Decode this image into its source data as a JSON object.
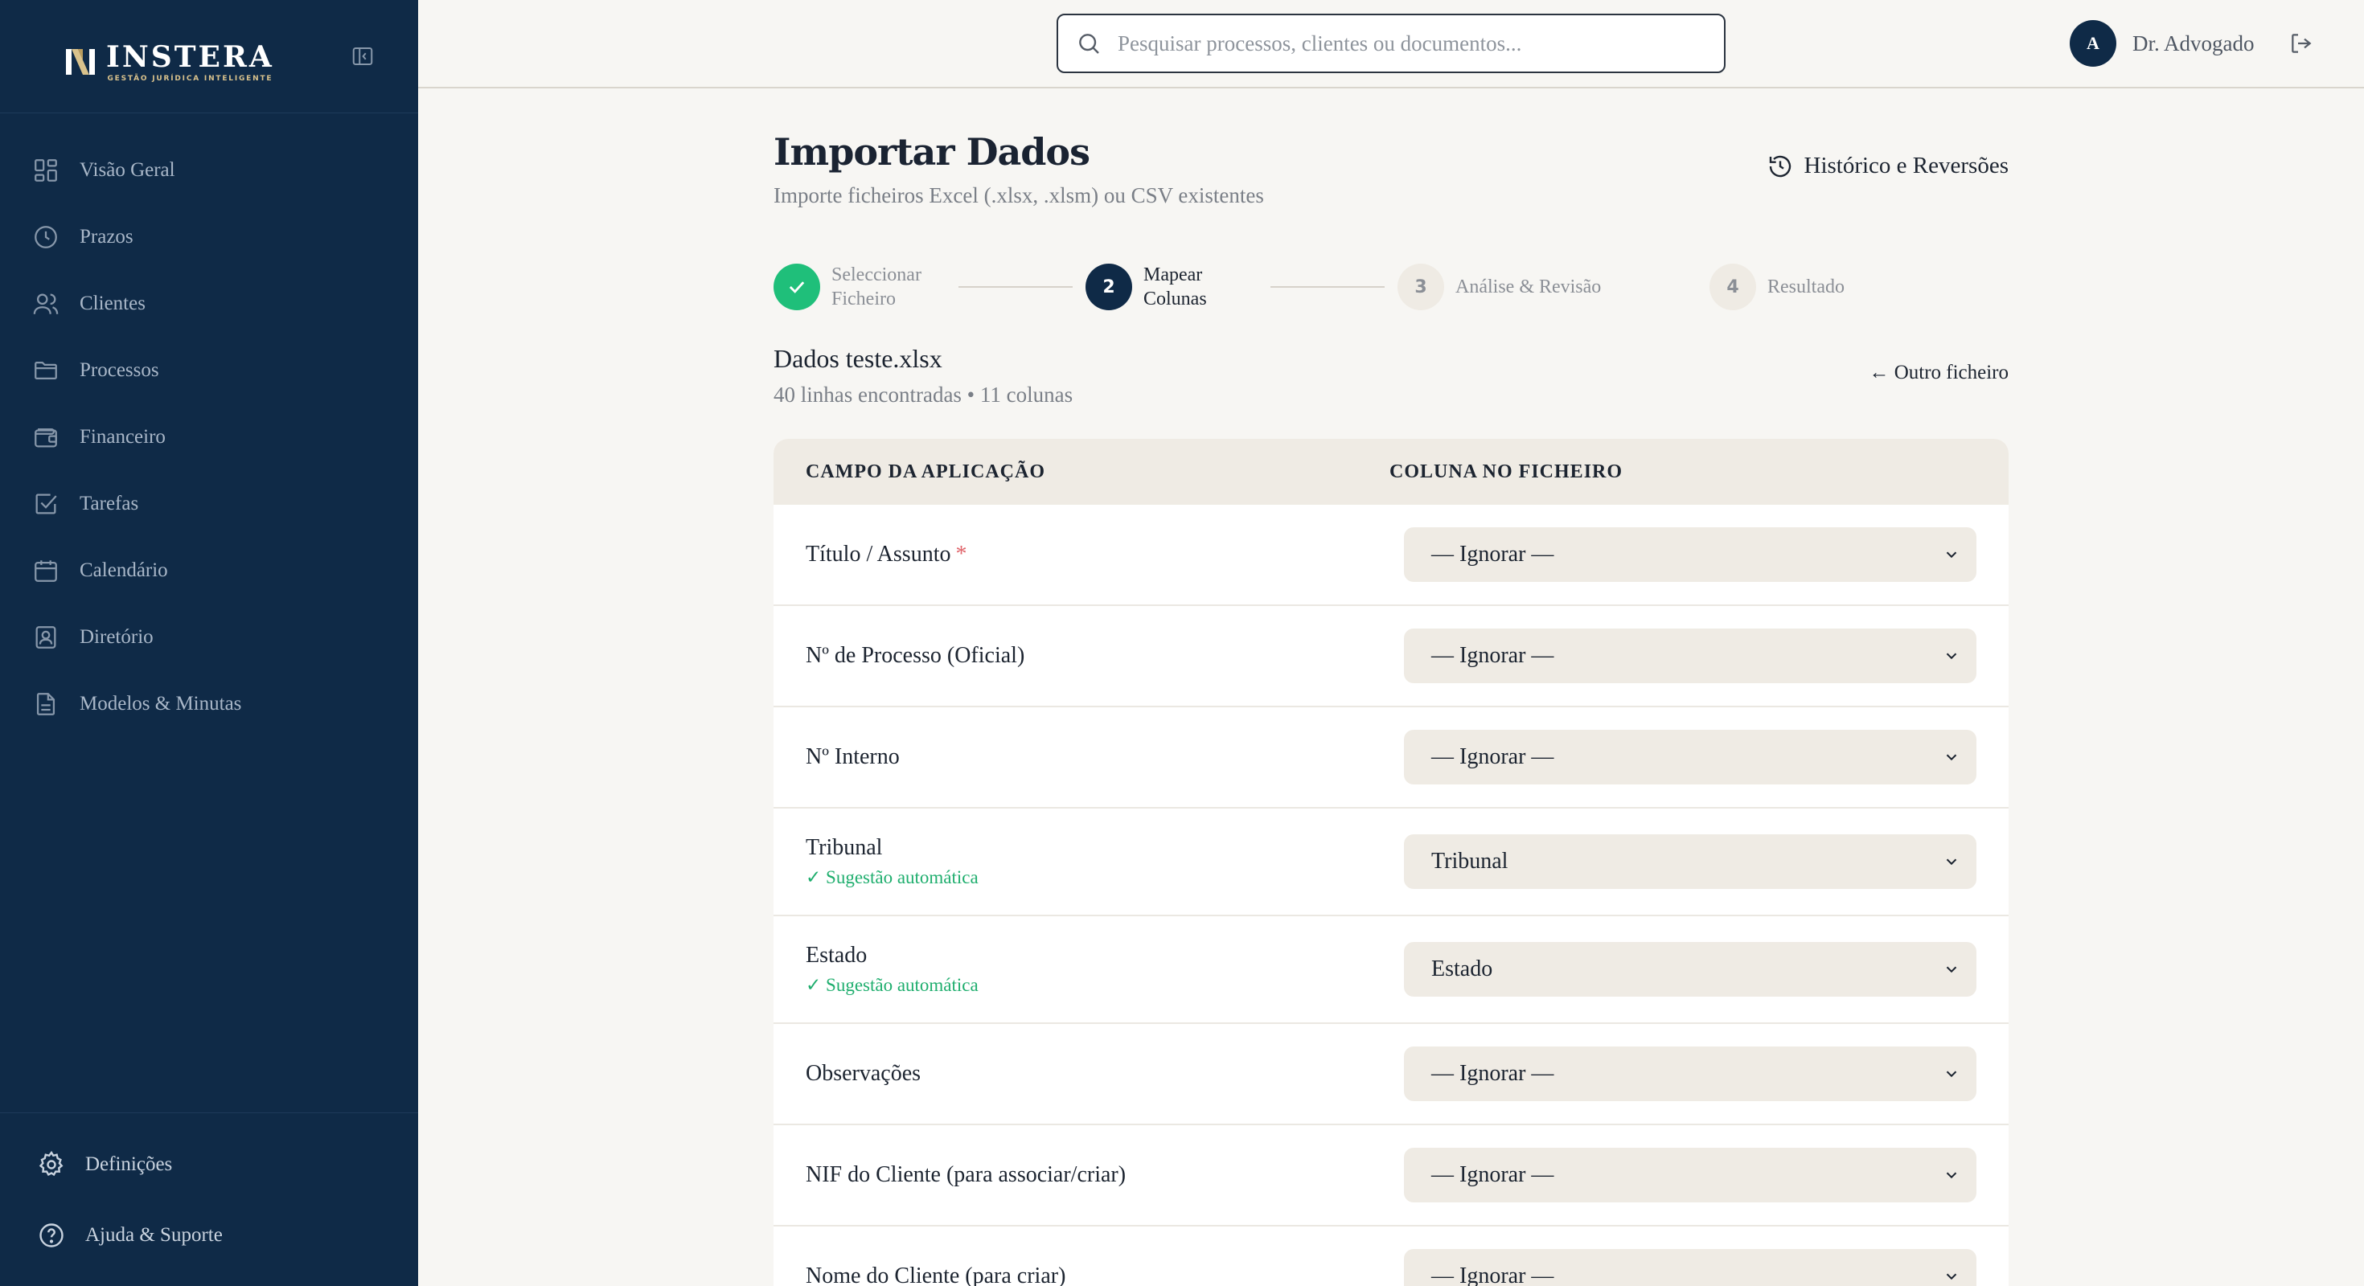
{
  "brand": {
    "name": "INSTERA",
    "tagline": "GESTÃO JURÍDICA INTELIGENTE",
    "accent_color": "#d9c28c"
  },
  "sidebar": {
    "items": [
      {
        "label": "Visão Geral",
        "icon": "grid-icon"
      },
      {
        "label": "Prazos",
        "icon": "clock-icon"
      },
      {
        "label": "Clientes",
        "icon": "users-icon"
      },
      {
        "label": "Processos",
        "icon": "folder-icon"
      },
      {
        "label": "Financeiro",
        "icon": "wallet-icon"
      },
      {
        "label": "Tarefas",
        "icon": "check-square-icon"
      },
      {
        "label": "Calendário",
        "icon": "calendar-icon"
      },
      {
        "label": "Diretório",
        "icon": "contact-icon"
      },
      {
        "label": "Modelos & Minutas",
        "icon": "document-icon"
      }
    ],
    "bottom": [
      {
        "label": "Definições",
        "icon": "gear-icon"
      },
      {
        "label": "Ajuda & Suporte",
        "icon": "help-icon"
      }
    ],
    "background_color": "#0f2a47"
  },
  "topbar": {
    "search_placeholder": "Pesquisar processos, clientes ou documentos...",
    "user_initial": "A",
    "user_name": "Dr. Advogado"
  },
  "page": {
    "title": "Importar Dados",
    "subtitle": "Importe ficheiros Excel (.xlsx, .xlsm) ou CSV existentes",
    "history_label": "Histórico e Reversões"
  },
  "stepper": {
    "steps": [
      {
        "number": "1",
        "line1": "Seleccionar",
        "line2": "Ficheiro",
        "status": "done"
      },
      {
        "number": "2",
        "line1": "Mapear",
        "line2": "Colunas",
        "status": "active"
      },
      {
        "number": "3",
        "line1": "Análise & Revisão",
        "line2": "",
        "status": "pending"
      },
      {
        "number": "4",
        "line1": "Resultado",
        "line2": "",
        "status": "pending"
      }
    ],
    "done_color": "#1fbf7a"
  },
  "file": {
    "name": "Dados teste.xlsx",
    "meta": "40 linhas encontradas • 11 colunas",
    "other_file_label": "← Outro ficheiro"
  },
  "mapping": {
    "header_field": "CAMPO DA APLICAÇÃO",
    "header_column": "COLUNA NO FICHEIRO",
    "required_marker": "*",
    "auto_suggestion": "✓ Sugestão automática",
    "rows": [
      {
        "field": "Título / Assunto",
        "value": "— Ignorar —"
      },
      {
        "field": "Nº de Processo (Oficial)",
        "value": "— Ignorar —"
      },
      {
        "field": "Nº Interno",
        "value": "— Ignorar —"
      },
      {
        "field": "Tribunal",
        "value": "Tribunal"
      },
      {
        "field": "Estado",
        "value": "Estado"
      },
      {
        "field": "Observações",
        "value": "— Ignorar —"
      },
      {
        "field": "NIF do Cliente (para associar/criar)",
        "value": "— Ignorar —"
      },
      {
        "field": "Nome do Cliente (para criar)",
        "value": "— Ignorar —"
      }
    ]
  }
}
